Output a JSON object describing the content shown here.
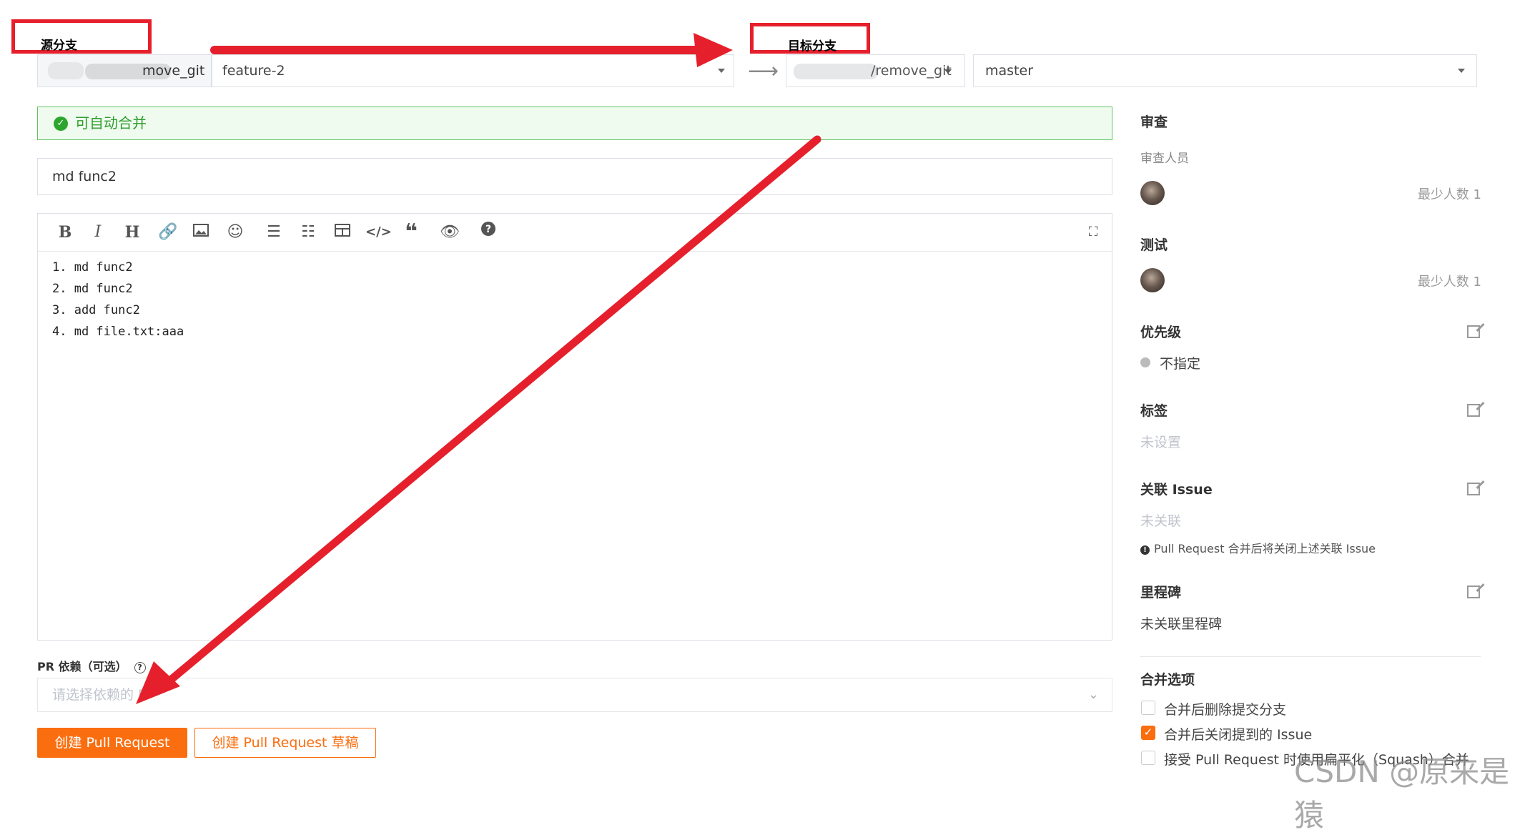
{
  "annotations": {
    "source_label": "源分支",
    "target_label": "目标分支"
  },
  "source": {
    "repo": "move_git",
    "branch": "feature-2"
  },
  "target": {
    "repo": "/remove_git",
    "branch": "master"
  },
  "status": {
    "text": "可自动合并",
    "color": "#2e9e2e"
  },
  "form": {
    "title": "md func2",
    "body_lines": [
      "1. md func2",
      "2. md func2",
      "3. add func2",
      "4. md file.txt:aaa"
    ],
    "dependency_label": "PR 依赖（可选）",
    "dependency_placeholder": "请选择依赖的 P",
    "create_button": "创建 Pull Request",
    "draft_button": "创建 Pull Request 草稿"
  },
  "toolbar": {
    "icons": [
      "bold-icon",
      "italic-icon",
      "heading-icon",
      "link-icon",
      "image-icon",
      "emoji-icon",
      "bullet-list-icon",
      "numbered-list-icon",
      "table-icon",
      "code-icon",
      "quote-icon",
      "preview-icon",
      "help-icon",
      "fullscreen-icon"
    ]
  },
  "sidebar": {
    "review_title": "审查",
    "reviewers_label": "审查人员",
    "review_min": "最少人数 1",
    "test_title": "测试",
    "test_min": "最少人数 1",
    "priority_title": "优先级",
    "priority_value": "不指定",
    "labels_title": "标签",
    "labels_value": "未设置",
    "issue_title": "关联 Issue",
    "issue_value": "未关联",
    "issue_note": "Pull Request 合并后将关闭上述关联 Issue",
    "milestone_title": "里程碑",
    "milestone_value": "未关联里程碑",
    "merge_title": "合并选项",
    "merge_options": [
      {
        "label": "合并后删除提交分支",
        "checked": false
      },
      {
        "label": "合并后关闭提到的 Issue",
        "checked": true
      },
      {
        "label": "接受 Pull Request 时使用扁平化（Squash）合并",
        "checked": false
      }
    ]
  },
  "watermark": "CSDN @原来是猿",
  "colors": {
    "accent": "#fa6e0f",
    "annotation_red": "#e5202c",
    "success": "#2e9e2e"
  }
}
